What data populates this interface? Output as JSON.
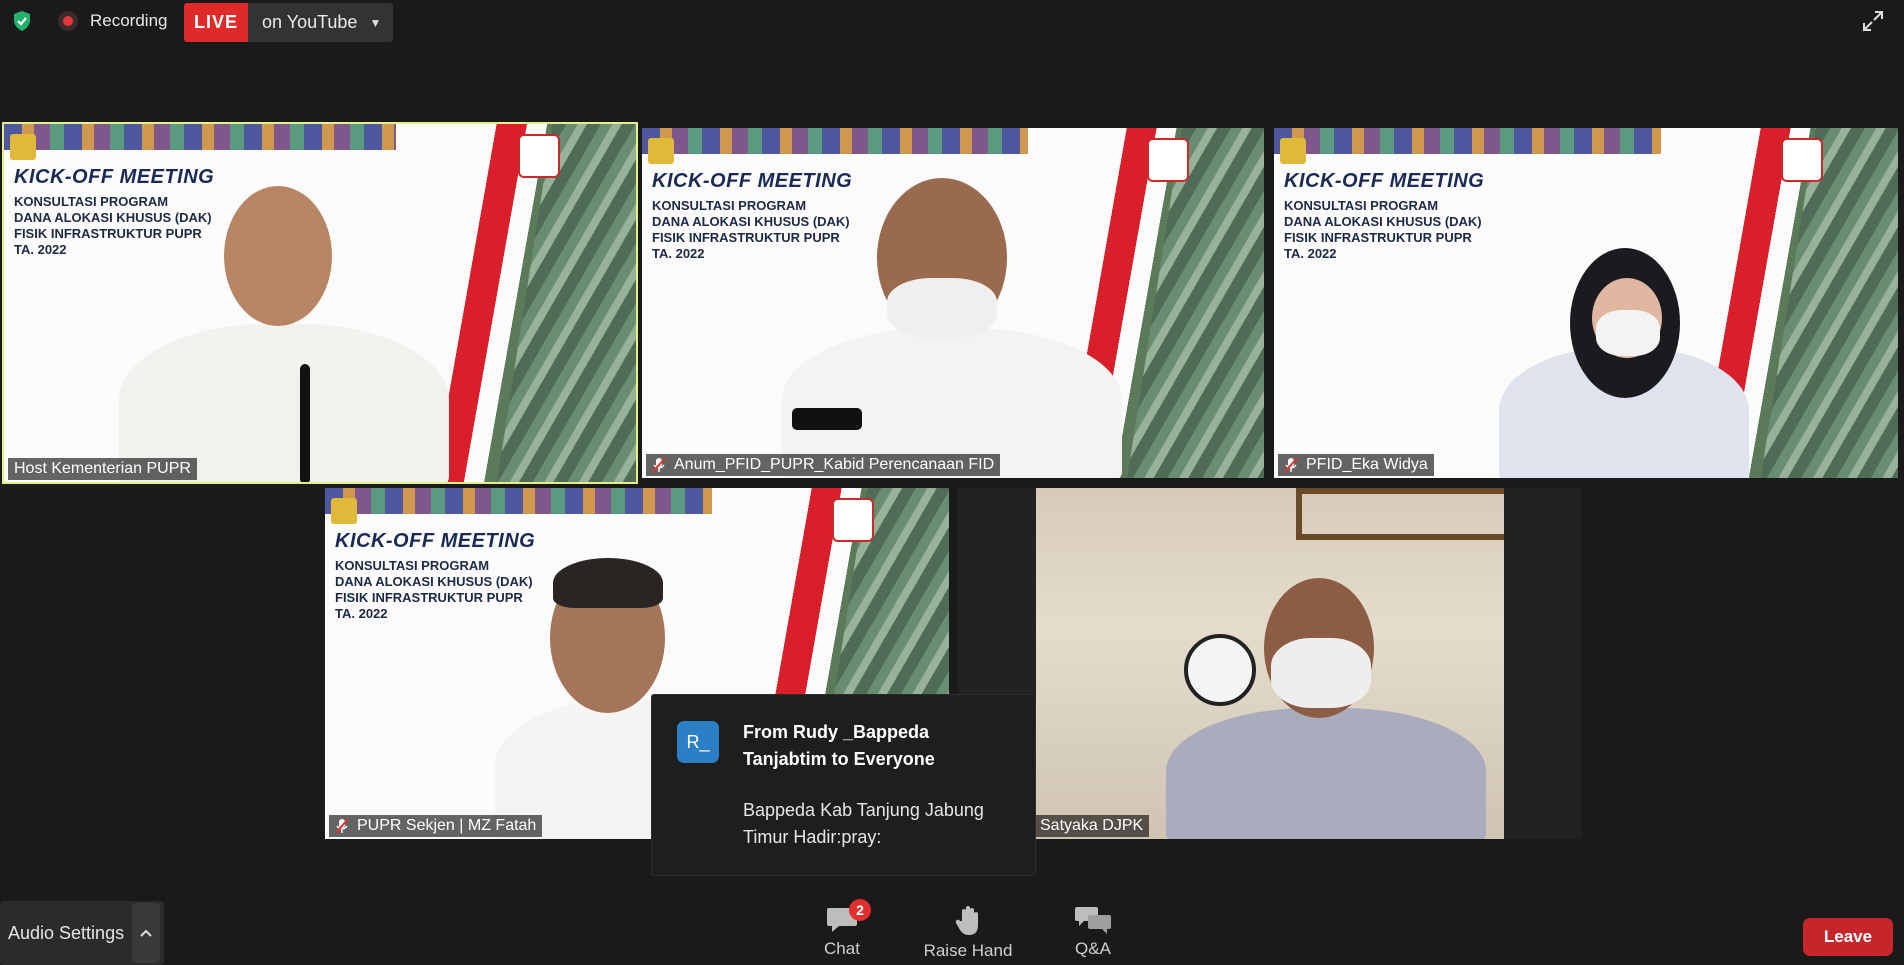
{
  "topbar": {
    "recording_label": "Recording",
    "live_badge": "LIVE",
    "live_target": "on YouTube"
  },
  "tiles": [
    {
      "name": "Host Kementerian PUPR",
      "slide_title": "KICK-OFF MEETING",
      "slide_lines": [
        "KONSULTASI PROGRAM",
        "DANA ALOKASI KHUSUS (DAK)",
        "FISIK INFRASTRUKTUR PUPR",
        "TA. 2022"
      ]
    },
    {
      "name": "Anum_PFID_PUPR_Kabid Perencanaan FID",
      "slide_title": "KICK-OFF MEETING",
      "slide_lines": [
        "KONSULTASI PROGRAM",
        "DANA ALOKASI KHUSUS (DAK)",
        "FISIK INFRASTRUKTUR PUPR",
        "TA. 2022"
      ]
    },
    {
      "name": "PFID_Eka Widya",
      "slide_title": "KICK-OFF MEETING",
      "slide_lines": [
        "KONSULTASI PROGRAM",
        "DANA ALOKASI KHUSUS (DAK)",
        "FISIK INFRASTRUKTUR PUPR",
        "TA. 2022"
      ]
    },
    {
      "name": "PUPR Sekjen | MZ Fatah",
      "slide_title": "KICK-OFF MEETING",
      "slide_lines": [
        "KONSULTASI PROGRAM",
        "DANA ALOKASI KHUSUS (DAK)",
        "FISIK INFRASTRUKTUR PUPR",
        "TA. 2022"
      ]
    },
    {
      "name": "Satyaka DJPK"
    }
  ],
  "chat_notification": {
    "avatar": "R_",
    "from": "From Rudy _Bappeda Tanjabtim to Everyone",
    "message": "Bappeda Kab Tanjung Jabung Timur Hadir:pray:"
  },
  "controls": {
    "audio_settings": "Audio Settings",
    "chat": "Chat",
    "chat_badge": "2",
    "raise_hand": "Raise Hand",
    "qa": "Q&A",
    "leave": "Leave"
  },
  "colors": {
    "active_speaker_border": "#e3f08a",
    "live_red": "#e02a2a",
    "leave_red": "#c6262b",
    "badge_red": "#e02f2f",
    "avatar_blue": "#2a7fc5"
  }
}
